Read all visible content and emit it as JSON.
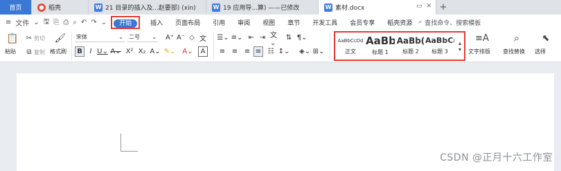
{
  "tabs": [
    {
      "label": "首页"
    },
    {
      "label": "稻壳"
    },
    {
      "label": "21 目录的插入及...赵要部) (xin)"
    },
    {
      "label": "19 应用导...算) ——已修改"
    },
    {
      "label": "素材.docx"
    }
  ],
  "tab_controls": {
    "new_tab": "+"
  },
  "menu": {
    "file": "文件",
    "start": "开始",
    "items": [
      "插入",
      "页面布局",
      "引用",
      "审阅",
      "视图",
      "章节",
      "开发工具",
      "会员专享",
      "稻壳资源"
    ],
    "search_hint": "查找命令、搜索模板"
  },
  "ribbon": {
    "paste": "粘贴",
    "cut": "剪切",
    "copy": "复制",
    "format_painter": "格式刷",
    "font_name": "宋体",
    "font_size": "二号",
    "styles": [
      {
        "preview": "AaBbCcDd",
        "name": "正文"
      },
      {
        "preview": "AaBb",
        "name": "标题 1"
      },
      {
        "preview": "AaBb(",
        "name": "标题 2"
      },
      {
        "preview": "AaBbC(",
        "name": "标题 3"
      }
    ],
    "text_layout": "文字排版",
    "find_replace": "查找替换",
    "select": "选择"
  },
  "watermark": "CSDN @正月十六工作室"
}
